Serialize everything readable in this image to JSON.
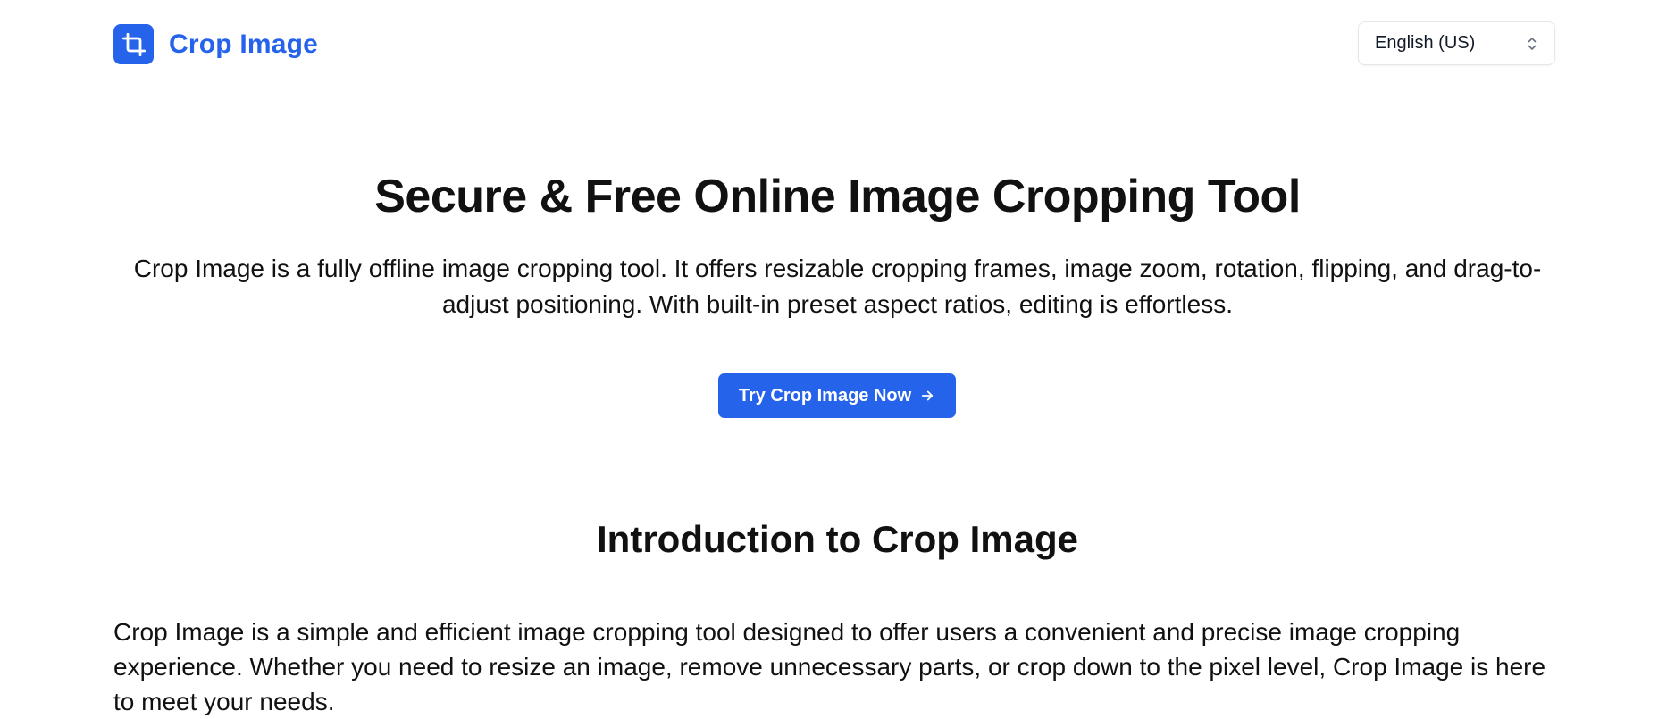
{
  "header": {
    "logo_text": "Crop Image",
    "logo_icon": "crop-icon",
    "language_selected": "English (US)",
    "language_icon": "chevron-up-down-icon"
  },
  "hero": {
    "title": "Secure & Free Online Image Cropping Tool",
    "description": "Crop Image is a fully offline image cropping tool. It offers resizable cropping frames, image zoom, rotation, flipping, and drag-to-adjust positioning. With built-in preset aspect ratios, editing is effortless.",
    "cta_label": "Try Crop Image Now",
    "cta_icon": "arrow-right-icon"
  },
  "intro": {
    "title": "Introduction to Crop Image",
    "text": "Crop Image is a simple and efficient image cropping tool designed to offer users a convenient and precise image cropping experience. Whether you need to resize an image, remove unnecessary parts, or crop down to the pixel level, Crop Image is here to meet your needs."
  },
  "colors": {
    "accent": "#2563eb",
    "text": "#111111",
    "border": "#e5e7eb",
    "background": "#ffffff"
  }
}
